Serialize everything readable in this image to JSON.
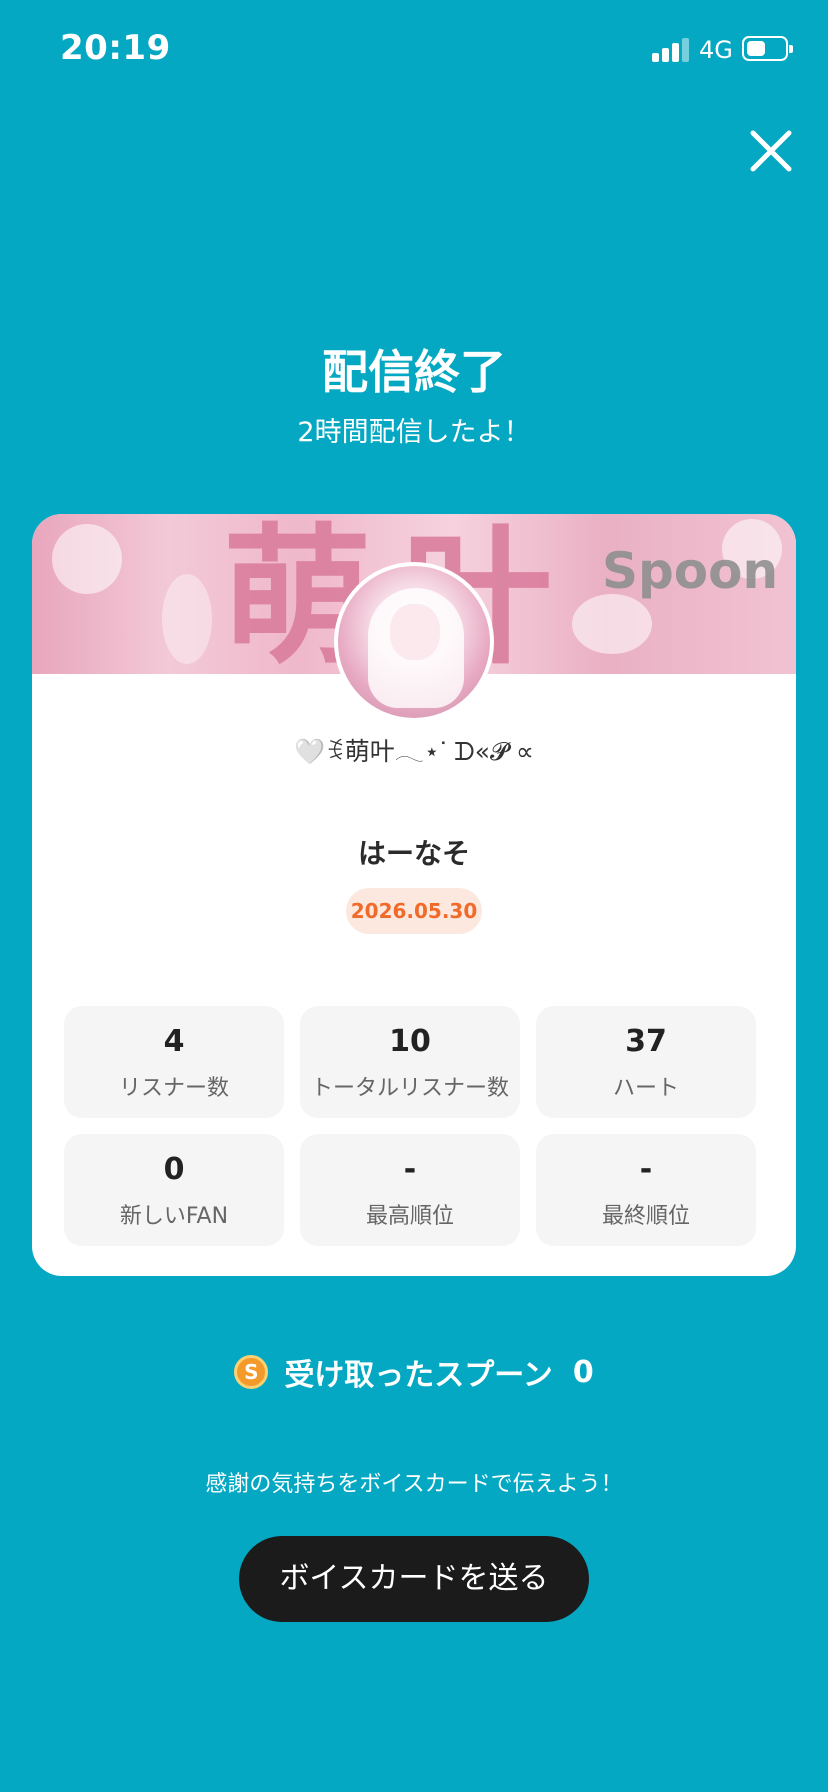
{
  "status_bar": {
    "time": "20:19",
    "network": "4G"
  },
  "header": {
    "title": "配信終了",
    "subtitle": "2時間配信したよ！"
  },
  "card": {
    "banner_text": "萌叶",
    "banner_brand": "Spoon",
    "dj_nickname": "🤍ꉂ萌叶𓂃⋆ᐝ ᗪ«𝓟 ∝",
    "listener_name": "はーなそ",
    "date": "2026.05.30",
    "stats": [
      {
        "value": "4",
        "label": "リスナー数"
      },
      {
        "value": "10",
        "label": "トータルリスナー数"
      },
      {
        "value": "37",
        "label": "ハート"
      },
      {
        "value": "0",
        "label": "新しいFAN"
      },
      {
        "value": "-",
        "label": "最高順位"
      },
      {
        "value": "-",
        "label": "最終順位"
      }
    ]
  },
  "spoon": {
    "icon_letter": "S",
    "label": "受け取ったスプーン",
    "count": "0"
  },
  "footer": {
    "thanks_text": "感謝の気持ちをボイスカードで伝えよう！",
    "button_label": "ボイスカードを送る"
  },
  "icons": {
    "close": "close-icon",
    "spoon": "spoon-coin-icon"
  },
  "colors": {
    "background": "#05a8c2",
    "badge_text": "#f06a2a",
    "badge_bg": "#fde8df",
    "button": "#1b1b1b"
  }
}
